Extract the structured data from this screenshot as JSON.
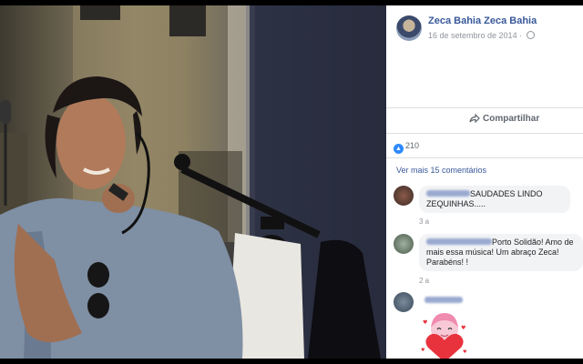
{
  "post": {
    "author": "Zeca Bahia Zeca Bahia",
    "date": "16 de setembro de 2014 · "
  },
  "actions": {
    "share_label": "Compartilhar"
  },
  "reactions": {
    "like_count": "210"
  },
  "comments_link": "Ver mais 15 comentários",
  "comments": [
    {
      "text": "SAUDADES LINDO ZEQUINHAS.....",
      "time": "3 a"
    },
    {
      "text": "Porto Solidão! Amo de mais essa música! Um abraço Zeca! Parabéns! !",
      "time": "2 a"
    },
    {
      "text": "",
      "time": ""
    }
  ],
  "colors": {
    "link": "#385898",
    "meta": "#90949c",
    "like": "#2e89ff"
  }
}
